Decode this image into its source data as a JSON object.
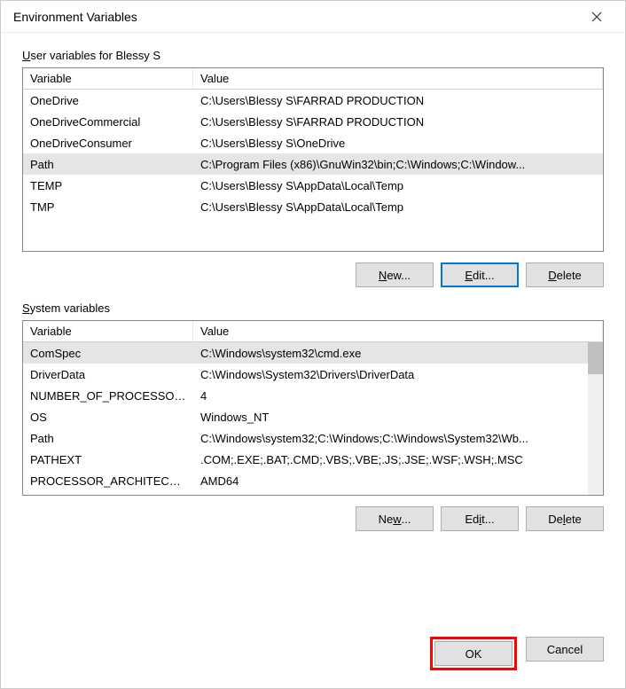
{
  "window": {
    "title": "Environment Variables"
  },
  "userGroup": {
    "label_prefix": "U",
    "label_rest": "ser variables for Blessy S",
    "columns": {
      "var": "Variable",
      "val": "Value"
    },
    "rows": [
      {
        "var": "OneDrive",
        "val": "C:\\Users\\Blessy S\\FARRAD PRODUCTION",
        "selected": false
      },
      {
        "var": "OneDriveCommercial",
        "val": "C:\\Users\\Blessy S\\FARRAD PRODUCTION",
        "selected": false
      },
      {
        "var": "OneDriveConsumer",
        "val": "C:\\Users\\Blessy S\\OneDrive",
        "selected": false
      },
      {
        "var": "Path",
        "val": "C:\\Program Files (x86)\\GnuWin32\\bin;C:\\Windows;C:\\Window...",
        "selected": true
      },
      {
        "var": "TEMP",
        "val": "C:\\Users\\Blessy S\\AppData\\Local\\Temp",
        "selected": false
      },
      {
        "var": "TMP",
        "val": "C:\\Users\\Blessy S\\AppData\\Local\\Temp",
        "selected": false
      }
    ],
    "buttons": {
      "new_accel": "N",
      "new_rest": "ew...",
      "edit_accel": "E",
      "edit_rest": "dit...",
      "delete_accel": "D",
      "delete_rest": "elete"
    }
  },
  "sysGroup": {
    "label_prefix": "S",
    "label_rest": "ystem variables",
    "columns": {
      "var": "Variable",
      "val": "Value"
    },
    "rows": [
      {
        "var": "ComSpec",
        "val": "C:\\Windows\\system32\\cmd.exe",
        "selected": true
      },
      {
        "var": "DriverData",
        "val": "C:\\Windows\\System32\\Drivers\\DriverData",
        "selected": false
      },
      {
        "var": "NUMBER_OF_PROCESSORS",
        "val": "4",
        "selected": false
      },
      {
        "var": "OS",
        "val": "Windows_NT",
        "selected": false
      },
      {
        "var": "Path",
        "val": "C:\\Windows\\system32;C:\\Windows;C:\\Windows\\System32\\Wb...",
        "selected": false
      },
      {
        "var": "PATHEXT",
        "val": ".COM;.EXE;.BAT;.CMD;.VBS;.VBE;.JS;.JSE;.WSF;.WSH;.MSC",
        "selected": false
      },
      {
        "var": "PROCESSOR_ARCHITECTU...",
        "val": "AMD64",
        "selected": false
      }
    ],
    "buttons": {
      "new_accel": "w",
      "new_pre": "Ne",
      "new_rest": "...",
      "edit_accel": "i",
      "edit_pre": "Ed",
      "edit_rest": "t...",
      "delete_accel": "l",
      "delete_pre": "De",
      "delete_rest": "ete"
    }
  },
  "footer": {
    "ok": "OK",
    "cancel": "Cancel"
  }
}
